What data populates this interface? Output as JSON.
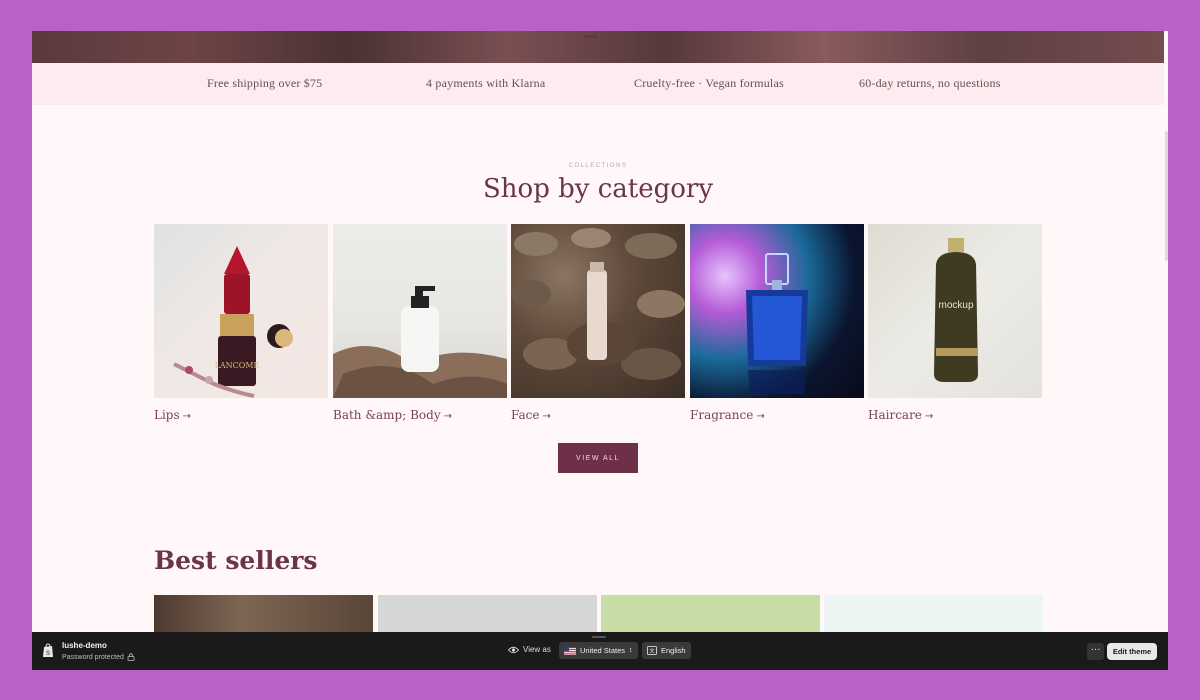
{
  "usp_bar": {
    "items": [
      "Free shipping over $75",
      "4 payments with Klarna",
      "Cruelty-free · Vegan formulas",
      "60-day returns, no questions"
    ]
  },
  "collections": {
    "eyebrow": "COLLECTIONS",
    "title": "Shop by category",
    "categories": [
      {
        "label": "Lips",
        "arrow": "→"
      },
      {
        "label": "Bath &amp; Body",
        "arrow": "→"
      },
      {
        "label": "Face",
        "arrow": "→"
      },
      {
        "label": "Fragrance",
        "arrow": "→"
      },
      {
        "label": "Haircare",
        "arrow": "→"
      }
    ],
    "view_all": "VIEW ALL"
  },
  "best_sellers": {
    "title": "Best sellers"
  },
  "images": {
    "lipstick_brand": "LANCOME",
    "haircare_brand": "mockup"
  },
  "admin_bar": {
    "store_name": "lushe-demo",
    "password_status": "Password protected",
    "view_as_label": "View as",
    "country": "United States",
    "language": "English",
    "more_label": "···",
    "edit_theme": "Edit theme"
  },
  "colors": {
    "brand": "#6e3048",
    "usp_bg": "#fdecef",
    "page_bg": "#fff7f8",
    "admin_bg": "#1a1a1a"
  }
}
